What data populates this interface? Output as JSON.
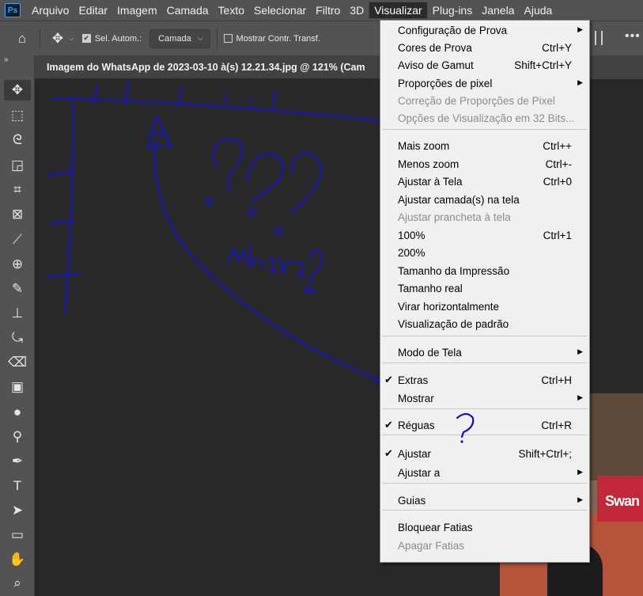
{
  "app": {
    "logo": "Ps"
  },
  "menubar": {
    "items": [
      "Arquivo",
      "Editar",
      "Imagem",
      "Camada",
      "Texto",
      "Selecionar",
      "Filtro",
      "3D",
      "Visualizar",
      "Plug-ins",
      "Janela",
      "Ajuda"
    ],
    "active": "Visualizar"
  },
  "options": {
    "home_icon": "home-icon",
    "move_icon": "move-icon",
    "auto_select_label": "Sel. Autom.:",
    "auto_select_checked": true,
    "target_value": "Camada",
    "show_transform_label": "Mostrar Contr. Transf.",
    "show_transform_checked": false,
    "more_label": "•••"
  },
  "document": {
    "tab_title": "Imagem do WhatsApp de 2023-03-10 à(s) 12.21.34.jpg @ 121% (Cam",
    "photo_sign_text": "Swan"
  },
  "annotation": {
    "handwriting": "Where?",
    "question_mark": "?"
  },
  "menu": {
    "items": [
      {
        "label": "Configuração de Prova",
        "shortcut": "",
        "submenu": true,
        "disabled": false,
        "checked": false
      },
      {
        "label": "Cores de Prova",
        "shortcut": "Ctrl+Y",
        "submenu": false,
        "disabled": false,
        "checked": false
      },
      {
        "label": "Aviso de Gamut",
        "shortcut": "Shift+Ctrl+Y",
        "submenu": false,
        "disabled": false,
        "checked": false
      },
      {
        "label": "Proporções de pixel",
        "shortcut": "",
        "submenu": true,
        "disabled": false,
        "checked": false
      },
      {
        "label": "Correção de Proporções de Pixel",
        "shortcut": "",
        "submenu": false,
        "disabled": true,
        "checked": false
      },
      {
        "label": "Opções de Visualização em 32 Bits...",
        "shortcut": "",
        "submenu": false,
        "disabled": true,
        "checked": false
      },
      {
        "label": "Mais zoom",
        "shortcut": "Ctrl++",
        "submenu": false,
        "disabled": false,
        "checked": false
      },
      {
        "label": "Menos zoom",
        "shortcut": "Ctrl+-",
        "submenu": false,
        "disabled": false,
        "checked": false
      },
      {
        "label": "Ajustar à Tela",
        "shortcut": "Ctrl+0",
        "submenu": false,
        "disabled": false,
        "checked": false
      },
      {
        "label": "Ajustar camada(s) na tela",
        "shortcut": "",
        "submenu": false,
        "disabled": false,
        "checked": false
      },
      {
        "label": "Ajustar prancheta à tela",
        "shortcut": "",
        "submenu": false,
        "disabled": true,
        "checked": false
      },
      {
        "label": "100%",
        "shortcut": "Ctrl+1",
        "submenu": false,
        "disabled": false,
        "checked": false
      },
      {
        "label": "200%",
        "shortcut": "",
        "submenu": false,
        "disabled": false,
        "checked": false
      },
      {
        "label": "Tamanho da Impressão",
        "shortcut": "",
        "submenu": false,
        "disabled": false,
        "checked": false
      },
      {
        "label": "Tamanho real",
        "shortcut": "",
        "submenu": false,
        "disabled": false,
        "checked": false
      },
      {
        "label": "Virar horizontalmente",
        "shortcut": "",
        "submenu": false,
        "disabled": false,
        "checked": false
      },
      {
        "label": "Visualização de padrão",
        "shortcut": "",
        "submenu": false,
        "disabled": false,
        "checked": false
      },
      {
        "label": "Modo de Tela",
        "shortcut": "",
        "submenu": true,
        "disabled": false,
        "checked": false
      },
      {
        "label": "Extras",
        "shortcut": "Ctrl+H",
        "submenu": false,
        "disabled": false,
        "checked": true
      },
      {
        "label": "Mostrar",
        "shortcut": "",
        "submenu": true,
        "disabled": false,
        "checked": false
      },
      {
        "label": "Réguas",
        "shortcut": "Ctrl+R",
        "submenu": false,
        "disabled": false,
        "checked": true
      },
      {
        "label": "Ajustar",
        "shortcut": "Shift+Ctrl+;",
        "submenu": false,
        "disabled": false,
        "checked": true
      },
      {
        "label": "Ajustar a",
        "shortcut": "",
        "submenu": true,
        "disabled": false,
        "checked": false
      },
      {
        "label": "Guias",
        "shortcut": "",
        "submenu": true,
        "disabled": false,
        "checked": false
      },
      {
        "label": "Bloquear Fatias",
        "shortcut": "",
        "submenu": false,
        "disabled": false,
        "checked": false
      },
      {
        "label": "Apagar Fatias",
        "shortcut": "",
        "submenu": false,
        "disabled": true,
        "checked": false
      }
    ],
    "check_glyph": "✔",
    "submenu_glyph": "▶"
  },
  "tools": {
    "collapse_glyph": "»",
    "items": [
      {
        "name": "move-tool",
        "glyph": "✥",
        "selected": true
      },
      {
        "name": "marquee-tool",
        "glyph": "⬚",
        "selected": false
      },
      {
        "name": "lasso-tool",
        "glyph": "ᘓ",
        "selected": false
      },
      {
        "name": "object-selection-tool",
        "glyph": "◲",
        "selected": false
      },
      {
        "name": "crop-tool",
        "glyph": "⌗",
        "selected": false
      },
      {
        "name": "frame-tool",
        "glyph": "⊠",
        "selected": false
      },
      {
        "name": "eyedropper-tool",
        "glyph": "⟋",
        "selected": false
      },
      {
        "name": "healing-brush-tool",
        "glyph": "⊕",
        "selected": false
      },
      {
        "name": "brush-tool",
        "glyph": "✎",
        "selected": false
      },
      {
        "name": "clone-stamp-tool",
        "glyph": "⊥",
        "selected": false
      },
      {
        "name": "history-brush-tool",
        "glyph": "⤿",
        "selected": false
      },
      {
        "name": "eraser-tool",
        "glyph": "⌫",
        "selected": false
      },
      {
        "name": "gradient-tool",
        "glyph": "▣",
        "selected": false
      },
      {
        "name": "blur-tool",
        "glyph": "●",
        "selected": false
      },
      {
        "name": "dodge-tool",
        "glyph": "⚲",
        "selected": false
      },
      {
        "name": "pen-tool",
        "glyph": "✒",
        "selected": false
      },
      {
        "name": "type-tool",
        "glyph": "T",
        "selected": false
      },
      {
        "name": "path-selection-tool",
        "glyph": "➤",
        "selected": false
      },
      {
        "name": "rectangle-tool",
        "glyph": "▭",
        "selected": false
      },
      {
        "name": "hand-tool",
        "glyph": "✋",
        "selected": false
      },
      {
        "name": "zoom-tool",
        "glyph": "⌕",
        "selected": false
      }
    ]
  }
}
